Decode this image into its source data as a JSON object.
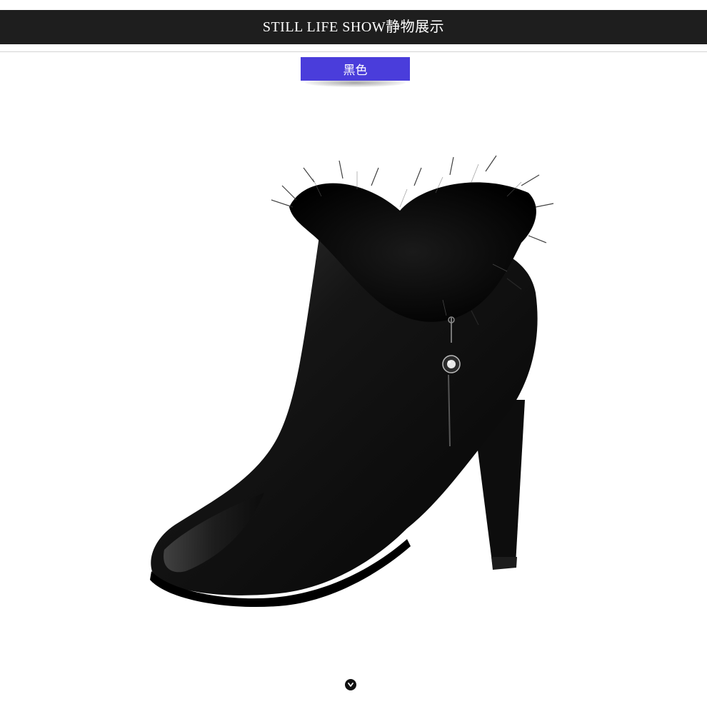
{
  "header": {
    "title": "STILL LIFE SHOW静物展示"
  },
  "color_tag": {
    "label": "黑色",
    "color": "#4a3ddb"
  },
  "product": {
    "icon": "ankle-boot-icon"
  },
  "scroll_badge": {
    "icon": "chevron-down-icon"
  }
}
